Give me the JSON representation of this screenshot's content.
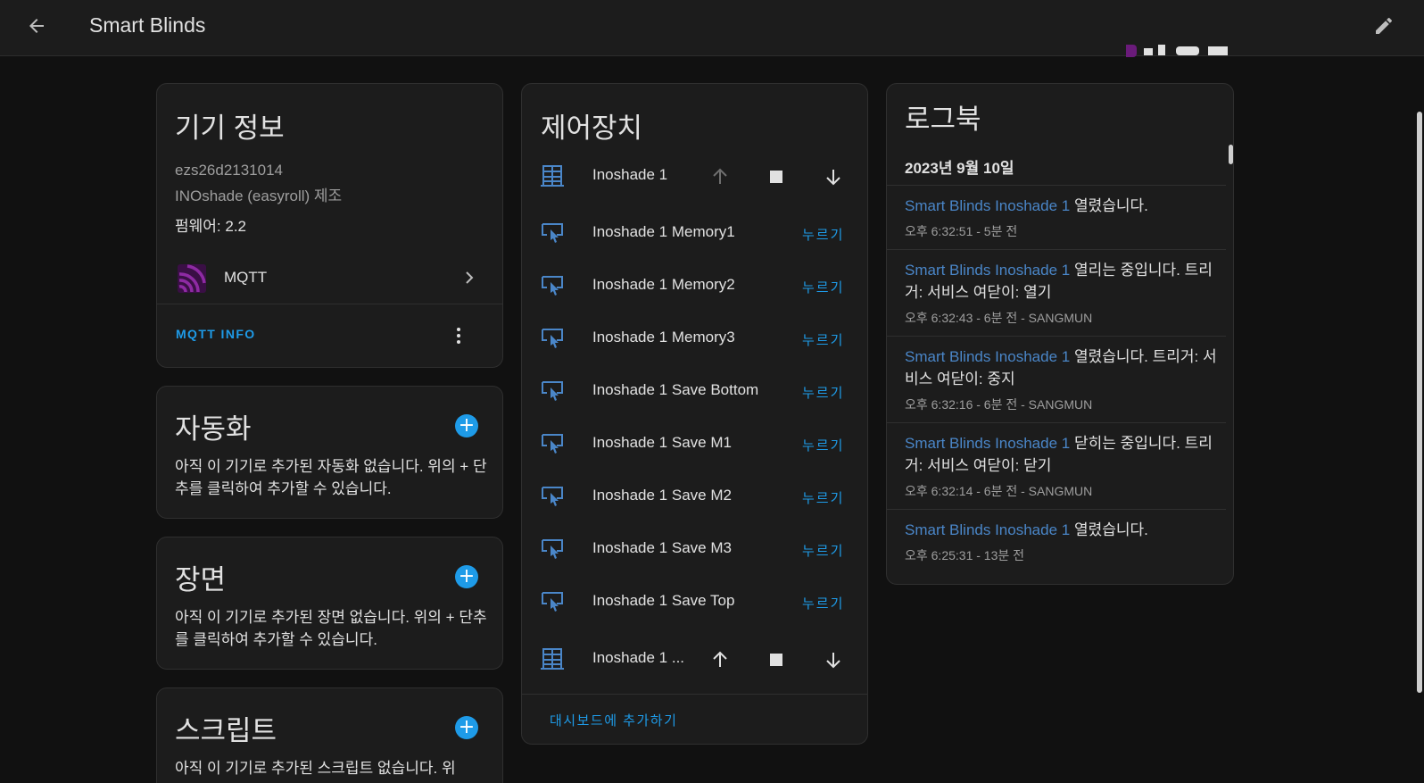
{
  "header": {
    "title": "Smart Blinds",
    "back_icon": "arrow-left-icon",
    "edit_icon": "pencil-icon"
  },
  "device_info": {
    "title": "기기 정보",
    "model": "ezs26d2131014",
    "manufacturer": "INOshade (easyroll) 제조",
    "firmware": "펌웨어: 2.2",
    "integration": {
      "label": "MQTT",
      "icon": "mqtt-icon",
      "icon_color": "#6a1b7a"
    },
    "action_label": "MQTT INFO"
  },
  "automation": {
    "title": "자동화",
    "empty_text": "아직 이 기기로 추가된 자동화 없습니다. 위의 + 단추를 클릭하여 추가할 수 있습니다."
  },
  "scenes": {
    "title": "장면",
    "empty_text": "아직 이 기기로 추가된 장면 없습니다. 위의 + 단추를 클릭하여 추가할 수 있습니다."
  },
  "scripts": {
    "title": "스크립트",
    "empty_text": "아직 이 기기로 추가된 스크립트 없습니다. 위"
  },
  "controls": {
    "title": "제어장치",
    "cover_top": {
      "label": "Inoshade 1",
      "icon": "blinds-icon",
      "up_enabled": false
    },
    "buttons": [
      {
        "label": "Inoshade 1 Memory1",
        "action": "누르기",
        "icon": "gesture-tap-button-icon"
      },
      {
        "label": "Inoshade 1 Memory2",
        "action": "누르기",
        "icon": "gesture-tap-button-icon"
      },
      {
        "label": "Inoshade 1 Memory3",
        "action": "누르기",
        "icon": "gesture-tap-button-icon"
      },
      {
        "label": "Inoshade 1 Save Bottom",
        "action": "누르기",
        "icon": "gesture-tap-button-icon"
      },
      {
        "label": "Inoshade 1 Save M1",
        "action": "누르기",
        "icon": "gesture-tap-button-icon"
      },
      {
        "label": "Inoshade 1 Save M2",
        "action": "누르기",
        "icon": "gesture-tap-button-icon"
      },
      {
        "label": "Inoshade 1 Save M3",
        "action": "누르기",
        "icon": "gesture-tap-button-icon"
      },
      {
        "label": "Inoshade 1 Save Top",
        "action": "누르기",
        "icon": "gesture-tap-button-icon"
      }
    ],
    "cover_bottom": {
      "label": "Inoshade 1 ...",
      "icon": "blinds-icon",
      "up_enabled": true
    },
    "add_to_dashboard": "대시보드에 추가하기"
  },
  "logbook": {
    "title": "로그북",
    "date": "2023년 9월 10일",
    "entries": [
      {
        "entity": "Smart Blinds Inoshade 1",
        "message": " 열렸습니다.",
        "meta": "오후 6:32:51 - 5분 전"
      },
      {
        "entity": "Smart Blinds Inoshade 1",
        "message": " 열리는 중입니다. 트리거: 서비스 여닫이: 열기",
        "meta": "오후 6:32:43 - 6분 전 - SANGMUN"
      },
      {
        "entity": "Smart Blinds Inoshade 1",
        "message": " 열렸습니다. 트리거: 서비스 여닫이: 중지",
        "meta": "오후 6:32:16 - 6분 전 - SANGMUN"
      },
      {
        "entity": "Smart Blinds Inoshade 1",
        "message": " 닫히는 중입니다. 트리거: 서비스 여닫이: 닫기",
        "meta": "오후 6:32:14 - 6분 전 - SANGMUN"
      },
      {
        "entity": "Smart Blinds Inoshade 1",
        "message": " 열렸습니다.",
        "meta": "오후 6:25:31 - 13분 전"
      }
    ]
  },
  "colors": {
    "accent": "#1e9be8",
    "link": "#4a86c8",
    "icon_blue": "#4a86c8",
    "background": "#111111",
    "card": "#1c1c1c"
  }
}
